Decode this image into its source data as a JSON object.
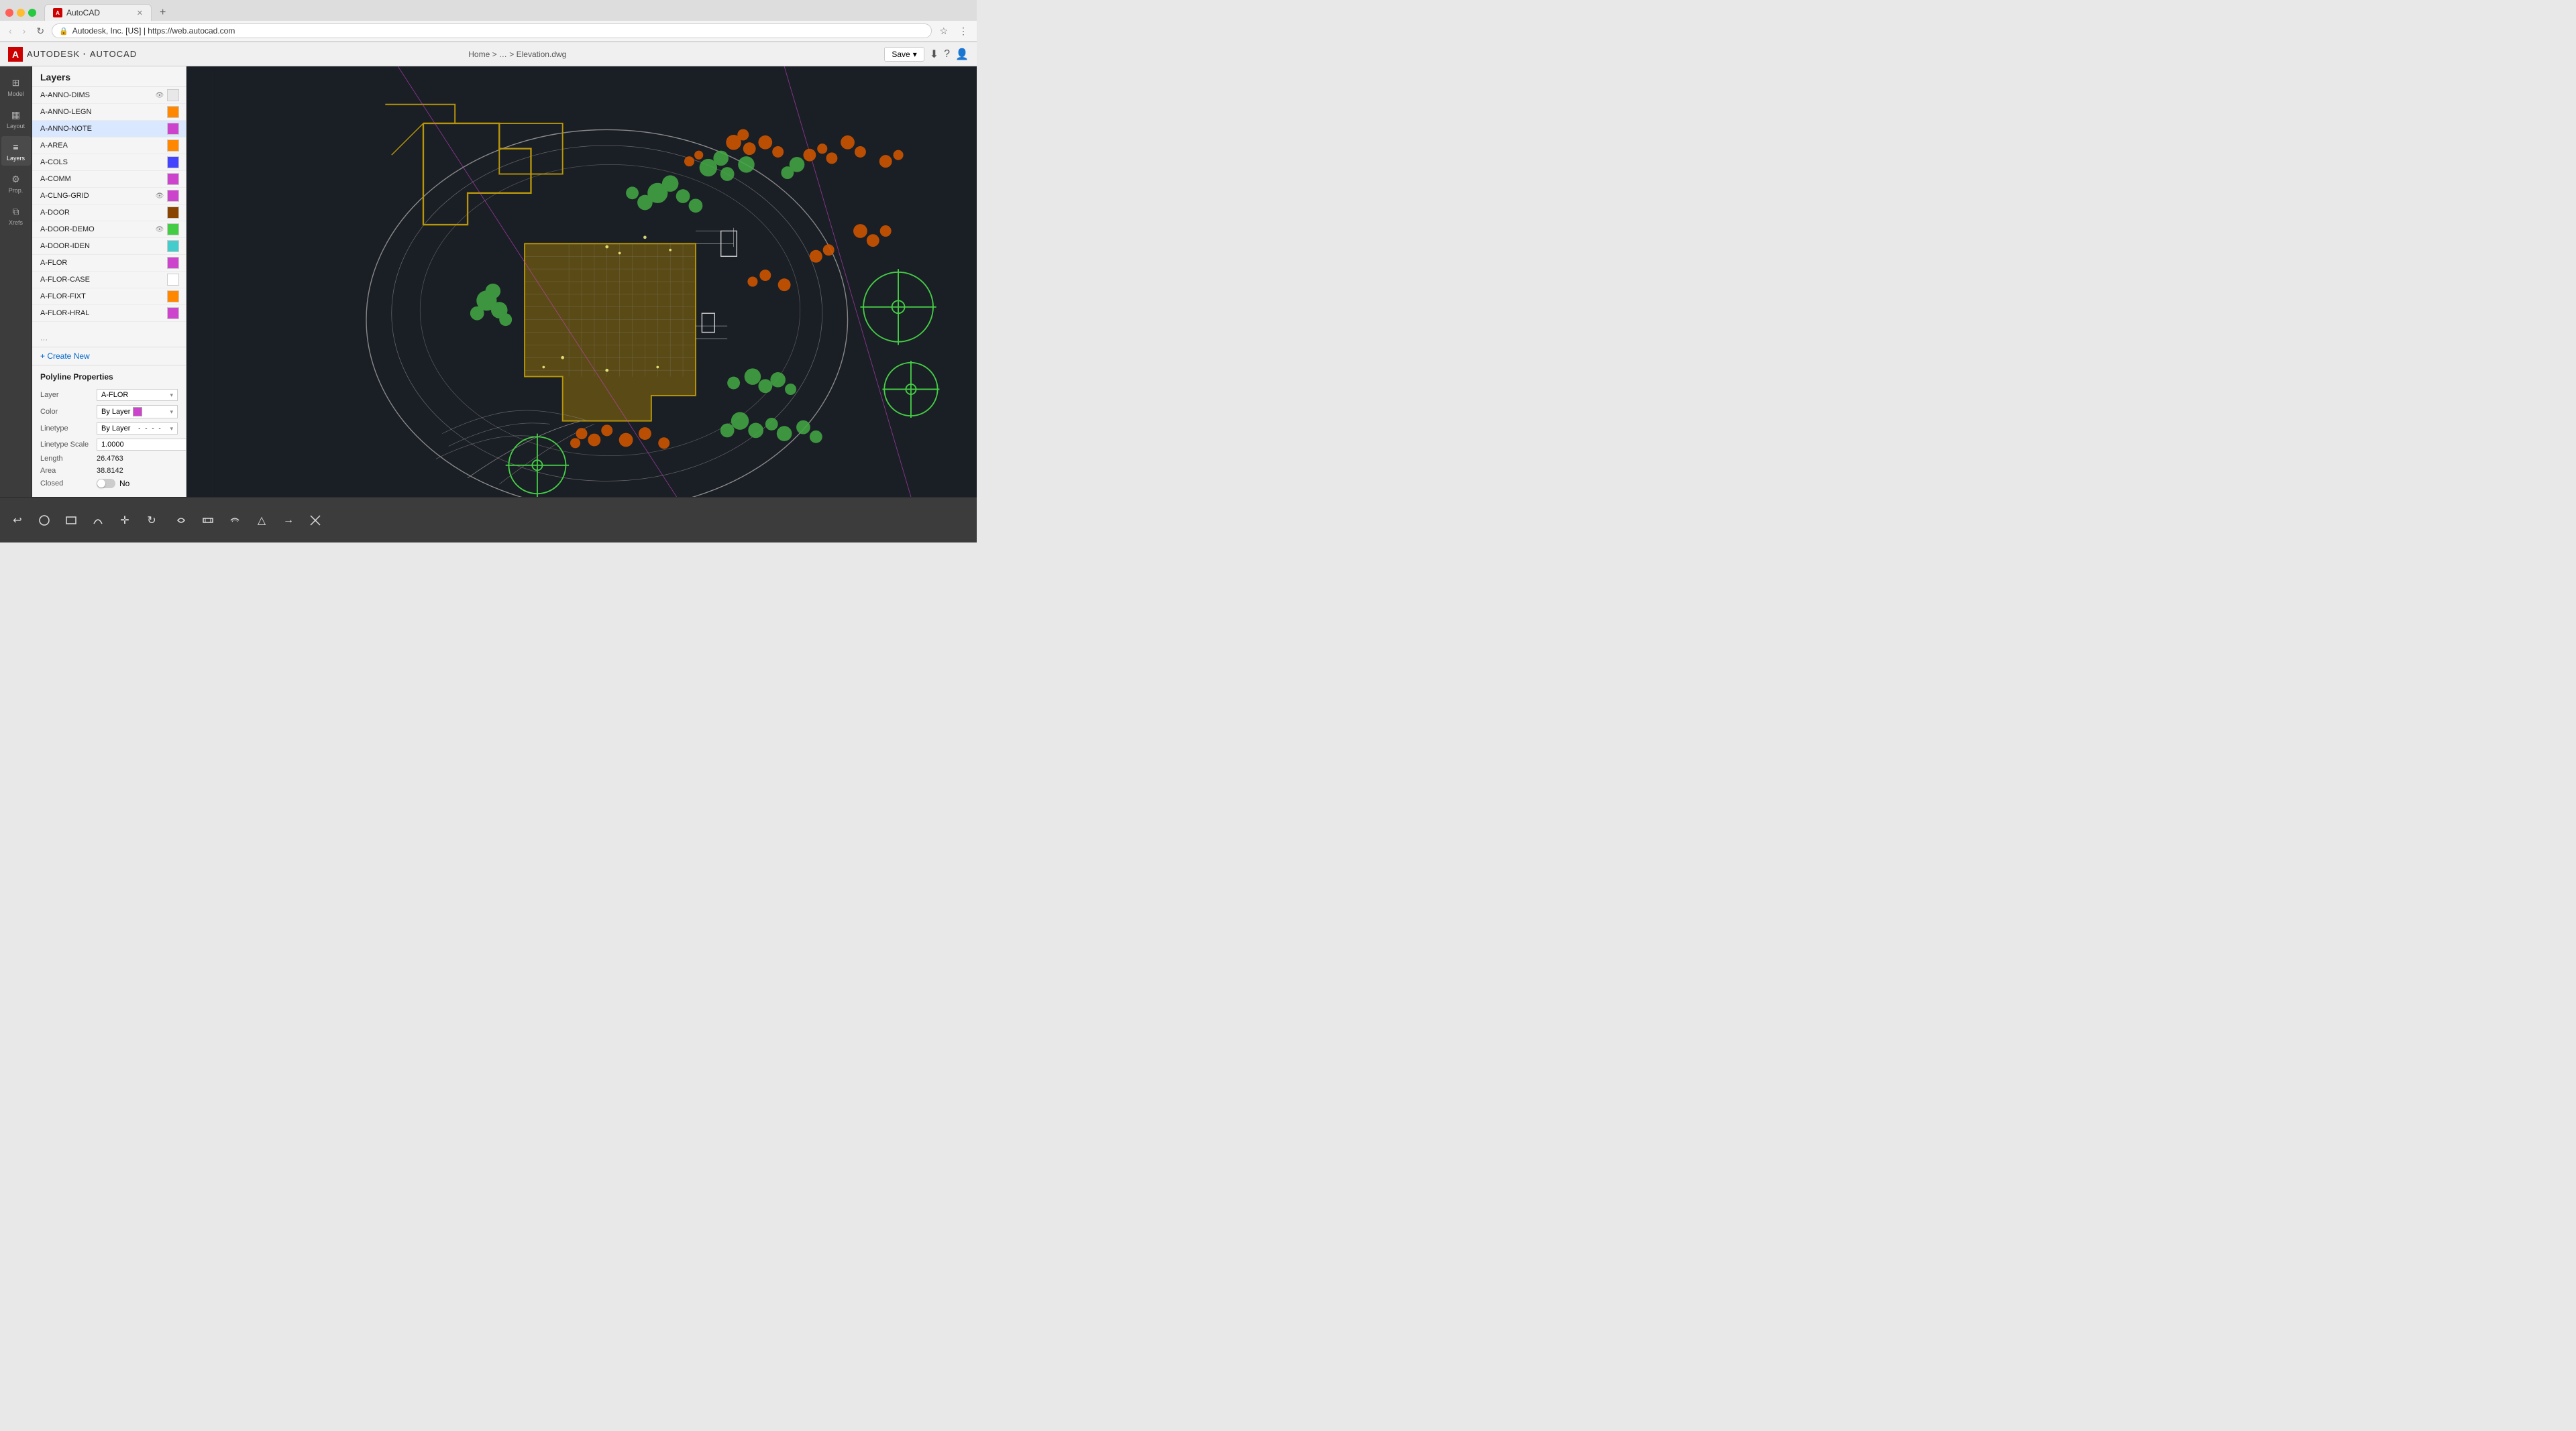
{
  "browser": {
    "tab_title": "AutoCAD",
    "tab_favicon": "A",
    "address": "https://web.autocad.com",
    "address_display": "Autodesk, Inc. [US] | https://web.autocad.com"
  },
  "header": {
    "logo_mark": "A",
    "logo_text": "AUTODESK",
    "logo_sub": "AUTOCAD",
    "breadcrumb": "Home > … > Elevation.dwg",
    "save_label": "Save",
    "download_icon": "⬇",
    "help_icon": "?",
    "user_icon": "👤"
  },
  "icon_sidebar": {
    "items": [
      {
        "id": "model",
        "label": "Model",
        "icon": "⊞",
        "active": false
      },
      {
        "id": "layout",
        "label": "Layout",
        "icon": "▦",
        "active": false
      },
      {
        "id": "layers",
        "label": "Layers",
        "icon": "≡",
        "active": true
      },
      {
        "id": "props",
        "label": "Prop.",
        "icon": "⚙",
        "active": false
      },
      {
        "id": "xrefs",
        "label": "Xrefs",
        "icon": "⧉",
        "active": false
      }
    ]
  },
  "layers_panel": {
    "title": "Layers",
    "items": [
      {
        "name": "A-ANNO-DIMS",
        "color": "#e8e8e8",
        "has_icon": true,
        "icon": "👁",
        "selected": false
      },
      {
        "name": "A-ANNO-LEGN",
        "color": "#ff8800",
        "has_icon": false,
        "selected": false
      },
      {
        "name": "A-ANNO-NOTE",
        "color": "#cc44cc",
        "has_icon": false,
        "selected": true
      },
      {
        "name": "A-AREA",
        "color": "#ff8800",
        "has_icon": false,
        "selected": false
      },
      {
        "name": "A-COLS",
        "color": "#4444ff",
        "has_icon": false,
        "selected": false
      },
      {
        "name": "A-COMM",
        "color": "#cc44cc",
        "has_icon": false,
        "selected": false
      },
      {
        "name": "A-CLNG-GRID",
        "color": "#cc44cc",
        "has_icon": true,
        "icon": "👁",
        "selected": false
      },
      {
        "name": "A-DOOR",
        "color": "#884400",
        "has_icon": false,
        "selected": false
      },
      {
        "name": "A-DOOR-DEMO",
        "color": "#44cc44",
        "has_icon": true,
        "icon": "👁",
        "selected": false
      },
      {
        "name": "A-DOOR-IDEN",
        "color": "#44cccc",
        "has_icon": false,
        "selected": false
      },
      {
        "name": "A-FLOR",
        "color": "#cc44cc",
        "has_icon": false,
        "selected": false
      },
      {
        "name": "A-FLOR-CASE",
        "color": "#ffffff",
        "has_icon": false,
        "selected": false
      },
      {
        "name": "A-FLOR-FIXT",
        "color": "#ff8800",
        "has_icon": false,
        "selected": false
      },
      {
        "name": "A-FLOR-HRAL",
        "color": "#cc44cc",
        "has_icon": false,
        "selected": false
      }
    ],
    "more_label": "···",
    "create_new_label": "+ Create New"
  },
  "polyline_properties": {
    "title": "Polyline Properties",
    "layer_label": "Layer",
    "layer_value": "A-FLOR",
    "color_label": "Color",
    "color_value": "By Layer",
    "color_swatch": "#cc44cc",
    "linetype_label": "Linetype",
    "linetype_value": "By Layer",
    "linetype_scale_label": "Linetype Scale",
    "linetype_scale_value": "1.0000",
    "length_label": "Length",
    "length_value": "26.4763",
    "area_label": "Area",
    "area_value": "38.8142",
    "closed_label": "Closed",
    "closed_value": "No",
    "closed_toggle": false
  },
  "toolbar": {
    "tools": [
      {
        "id": "undo",
        "icon": "↩",
        "label": "undo"
      },
      {
        "id": "circle",
        "icon": "○",
        "label": "circle"
      },
      {
        "id": "rectangle",
        "icon": "▭",
        "label": "rectangle"
      },
      {
        "id": "arc",
        "icon": "⌒",
        "label": "arc"
      },
      {
        "id": "move",
        "icon": "✛",
        "label": "move"
      },
      {
        "id": "rotate",
        "icon": "↻",
        "label": "rotate"
      },
      {
        "id": "lasso",
        "icon": "⌓",
        "label": "lasso"
      },
      {
        "id": "measure",
        "icon": "⊟",
        "label": "measure"
      },
      {
        "id": "offset",
        "icon": "⊂",
        "label": "offset"
      },
      {
        "id": "triangle",
        "icon": "△",
        "label": "triangle"
      },
      {
        "id": "arrow",
        "icon": "→",
        "label": "arrow"
      },
      {
        "id": "trim",
        "icon": "✂",
        "label": "trim"
      }
    ]
  }
}
